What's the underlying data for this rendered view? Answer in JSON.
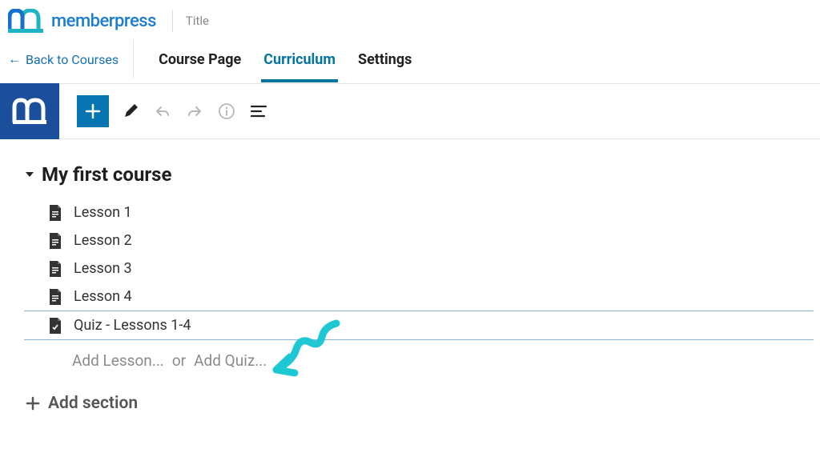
{
  "header": {
    "brand": "memberpress",
    "title_label": "Title",
    "back_link": "Back to Courses"
  },
  "tabs": [
    {
      "id": "course-page",
      "label": "Course Page",
      "active": false
    },
    {
      "id": "curriculum",
      "label": "Curriculum",
      "active": true
    },
    {
      "id": "settings",
      "label": "Settings",
      "active": false
    }
  ],
  "course": {
    "section_title": "My first course",
    "items": [
      {
        "type": "lesson",
        "label": "Lesson 1"
      },
      {
        "type": "lesson",
        "label": "Lesson 2"
      },
      {
        "type": "lesson",
        "label": "Lesson 3"
      },
      {
        "type": "lesson",
        "label": "Lesson 4"
      },
      {
        "type": "quiz",
        "label": "Quiz - Lessons 1-4"
      }
    ],
    "add_lesson_label": "Add Lesson...",
    "add_links_separator": "or",
    "add_quiz_label": "Add Quiz...",
    "add_section_label": "Add section"
  }
}
